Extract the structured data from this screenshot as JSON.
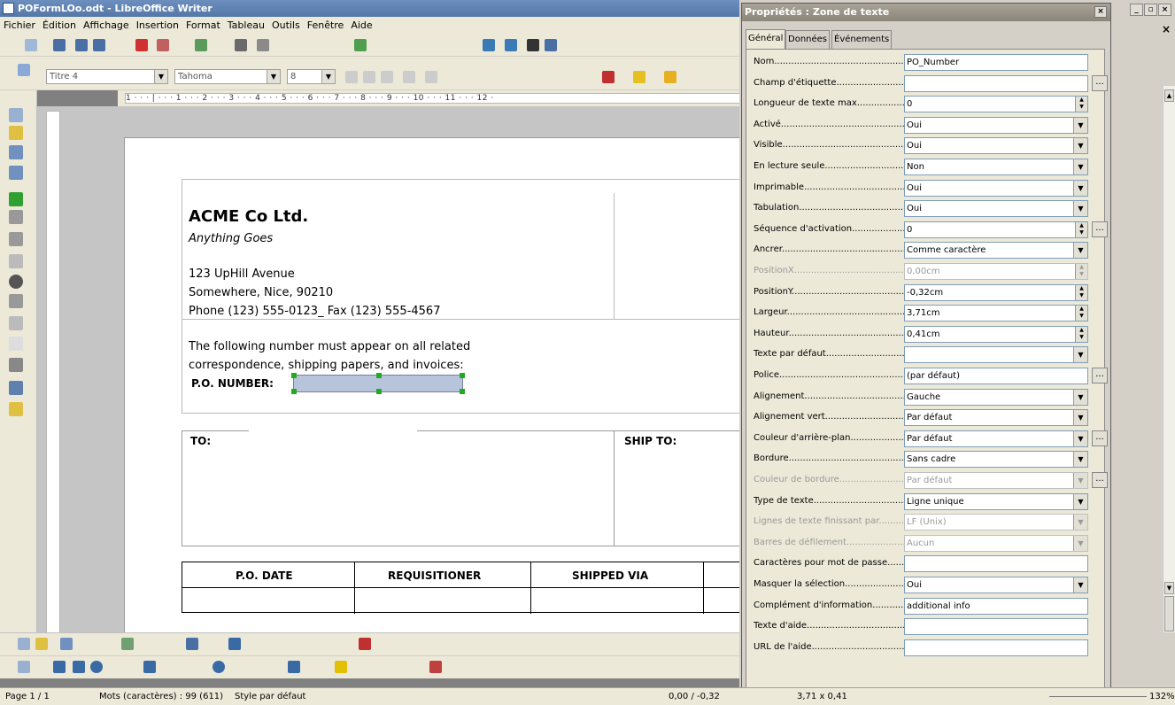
{
  "writer": {
    "title": "POFormLOo.odt - LibreOffice Writer",
    "menu": [
      "Fichier",
      "Édition",
      "Affichage",
      "Insertion",
      "Format",
      "Tableau",
      "Outils",
      "Fenêtre",
      "Aide"
    ],
    "style_combo": "Titre 4",
    "font_combo": "Tahoma",
    "size_combo": "8",
    "ruler_text": "1 · · · |  · · · 1 · · · 2 · · · 3 · · · 4 · · · 5 · · · 6 · · · 7 · · · 8 · · · 9 · · · 10 · · · 11 · · · 12 ·"
  },
  "document": {
    "company": "ACME Co Ltd.",
    "tagline": "Anything Goes",
    "address1": "123 UpHill Avenue",
    "address2": "Somewhere, Nice, 90210",
    "phone": "Phone (123) 555-0123_ Fax (123) 555-4567",
    "note1": "The following number must appear on all related",
    "note2": "correspondence, shipping papers, and invoices:",
    "po_label": "P.O. NUMBER:",
    "to_label": "TO:",
    "ship_to_label": "SHIP TO:",
    "table_headers": [
      "P.O. DATE",
      "REQUISITIONER",
      "SHIPPED VIA"
    ]
  },
  "status": {
    "page": "Page 1 / 1",
    "words": "Mots (caractères) : 99 (611)",
    "style": "Style par défaut",
    "position": "0,00 / -0,32",
    "size": "3,71 x 0,41",
    "zoom": "132%"
  },
  "dialog": {
    "title": "Propriétés : Zone de texte",
    "tabs": [
      "Général",
      "Données",
      "Événements"
    ],
    "rows": [
      {
        "label": "Nom",
        "value": "PO_Number",
        "kind": "text",
        "dim": false,
        "ell": false
      },
      {
        "label": "Champ d'étiquette",
        "value": "",
        "kind": "text",
        "dim": false,
        "ell": true
      },
      {
        "label": "Longueur de texte max",
        "value": "0",
        "kind": "spin",
        "dim": false,
        "ell": false
      },
      {
        "label": "Activé",
        "value": "Oui",
        "kind": "dd",
        "dim": false,
        "ell": false
      },
      {
        "label": "Visible",
        "value": "Oui",
        "kind": "dd",
        "dim": false,
        "ell": false
      },
      {
        "label": "En lecture seule",
        "value": "Non",
        "kind": "dd",
        "dim": false,
        "ell": false
      },
      {
        "label": "Imprimable",
        "value": "Oui",
        "kind": "dd",
        "dim": false,
        "ell": false
      },
      {
        "label": "Tabulation",
        "value": "Oui",
        "kind": "dd",
        "dim": false,
        "ell": false
      },
      {
        "label": "Séquence d'activation",
        "value": "0",
        "kind": "spin",
        "dim": false,
        "ell": true
      },
      {
        "label": "Ancrer",
        "value": "Comme caractère",
        "kind": "dd",
        "dim": false,
        "ell": false
      },
      {
        "label": "PositionX",
        "value": "0,00cm",
        "kind": "spin",
        "dim": true,
        "ell": false
      },
      {
        "label": "PositionY",
        "value": "-0,32cm",
        "kind": "spin",
        "dim": false,
        "ell": false
      },
      {
        "label": "Largeur",
        "value": "3,71cm",
        "kind": "spin",
        "dim": false,
        "ell": false
      },
      {
        "label": "Hauteur",
        "value": "0,41cm",
        "kind": "spin",
        "dim": false,
        "ell": false
      },
      {
        "label": "Texte par défaut",
        "value": "",
        "kind": "dd",
        "dim": false,
        "ell": false
      },
      {
        "label": "Police",
        "value": "(par défaut)",
        "kind": "text",
        "dim": false,
        "ell": true
      },
      {
        "label": "Alignement",
        "value": "Gauche",
        "kind": "dd",
        "dim": false,
        "ell": false
      },
      {
        "label": "Alignement vert.",
        "value": "Par défaut",
        "kind": "dd",
        "dim": false,
        "ell": false
      },
      {
        "label": "Couleur d'arrière-plan",
        "value": "Par défaut",
        "kind": "dd",
        "dim": false,
        "ell": true
      },
      {
        "label": "Bordure",
        "value": "Sans cadre",
        "kind": "dd",
        "dim": false,
        "ell": false
      },
      {
        "label": "Couleur de bordure",
        "value": "Par défaut",
        "kind": "dd",
        "dim": true,
        "ell": true
      },
      {
        "label": "Type de texte",
        "value": "Ligne unique",
        "kind": "dd",
        "dim": false,
        "ell": false
      },
      {
        "label": "Lignes de texte finissant par",
        "value": "LF (Unix)",
        "kind": "dd",
        "dim": true,
        "ell": false
      },
      {
        "label": "Barres de défilement",
        "value": "Aucun",
        "kind": "dd",
        "dim": true,
        "ell": false
      },
      {
        "label": "Caractères pour mot de passe",
        "value": "",
        "kind": "text",
        "dim": false,
        "ell": false
      },
      {
        "label": "Masquer la sélection",
        "value": "Oui",
        "kind": "dd",
        "dim": false,
        "ell": false
      },
      {
        "label": "Complément d'information",
        "value": "additional info",
        "kind": "text",
        "dim": false,
        "ell": false
      },
      {
        "label": "Texte d'aide",
        "value": "",
        "kind": "text",
        "dim": false,
        "ell": false
      },
      {
        "label": "URL de l'aide",
        "value": "",
        "kind": "text",
        "dim": false,
        "ell": false
      }
    ]
  },
  "colors": {
    "selection_fill": "#b8c4dc",
    "handle": "#22aa22",
    "dialog_title": "#8b8679"
  }
}
